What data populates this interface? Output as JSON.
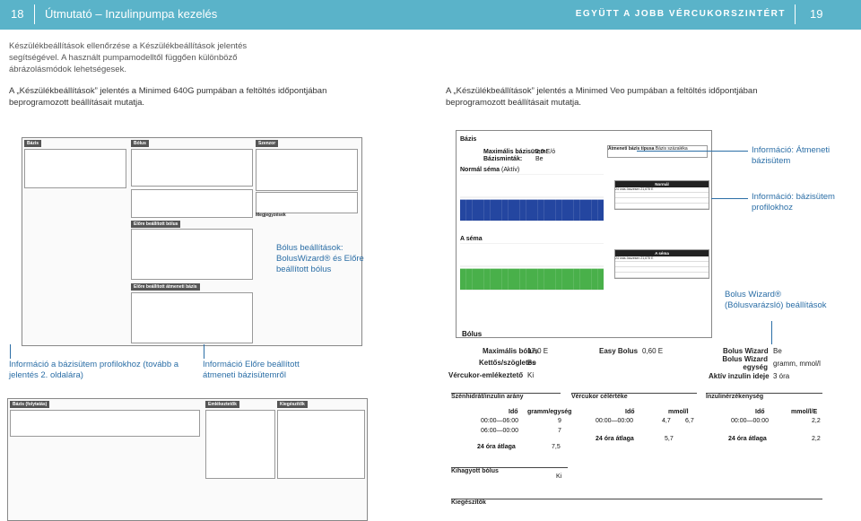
{
  "header": {
    "page_left": "18",
    "title_left": "Útmutató – Inzulinpumpa kezelés",
    "title_right": "EGYÜTT A JOBB VÉRCUKORSZINTÉRT",
    "page_right": "19"
  },
  "intro": "Készülékbeállítások ellenőrzése a Készülékbeállítások jelentés segítségével. A használt pumpamodelltől függően különböző ábrázolásmódok lehetségesek.",
  "caption_left": "A „Készülékbeállítások” jelentés a Minimed 640G pumpában a feltöltés időpontjában beprogramozott beállításait mutatja.",
  "caption_right": "A „Készülékbeállítások” jelentés a Minimed Veo pumpában a feltöltés időpontjában beprogramozott beállításait mutatja.",
  "notes": {
    "temp_basal": "Információ: Átmeneti bázisütem",
    "basal_profiles": "Információ: bázisütem profilokhoz",
    "bolus_settings": "Bólus beállítások: BolusWizard® és Előre beállított bólus",
    "bolus_wizard": "Bolus Wizard® (Bólusvarázsló) beállítások",
    "basal_info_continued": "Információ a bázisütem profilokhoz (tovább a jelentés 2. oldalára)",
    "preset_temp": "Információ Előre beállított átmeneti bázisütemről"
  },
  "mini640": {
    "bazis": "Bázis",
    "bolus": "Bólus",
    "szenzor": "Szenzor",
    "elore_bolus": "Előre beállított bólus",
    "elore_atmeneti": "Előre beállított átmeneti bázis",
    "bazis_folytatas": "Bázis (folytatás)",
    "emlekeztetok": "Emlékeztetők",
    "kiegeszitok": "Kiegészítők",
    "megjegyzesek": "Megjegyzések"
  },
  "veo": {
    "title": "Bázis",
    "max_basal_label": "Maximális bázisütem:",
    "max_basal_value": "2,0 E/ó",
    "basal_patterns_label": "Bázisminták:",
    "basal_patterns_value": "Be",
    "normal_label": "Normál séma",
    "active": "(Aktív)",
    "a_schema": "A séma",
    "temp_basal_type_label": "Átmeneti bázis típusa",
    "temp_basal_type_value": "Bázis százaléka",
    "normal_table_title": "Normál",
    "a_table_title": "A séma",
    "normal_total": "24 órás összesen 21,675 E",
    "a_total": "24 órás összesen 21,675 E",
    "bolus_title": "Bólus",
    "max_bolus_label": "Maximális bólus",
    "max_bolus_value": "17,0 E",
    "dual_square_label": "Kettős/szögletes",
    "dual_square_value": "Be",
    "bg_reminder_label": "Vércukor-emlékeztető",
    "bg_reminder_value": "Ki",
    "easy_bolus_label": "Easy Bolus",
    "easy_bolus_value": "0,60 E",
    "bolus_wizard_label": "Bolus Wizard",
    "bolus_wizard_value": "Be",
    "bw_unit_label": "Bolus Wizard egység",
    "bw_unit_value": "gramm, mmol/l",
    "active_insulin_label": "Aktív inzulin ideje",
    "active_insulin_value": "3 óra",
    "carb_ratio_title": "Szénhidrát/inzulin arány",
    "bg_target_title": "Vércukor célértéke",
    "isf_title": "Inzulinérzékenység",
    "col_ido": "Idő",
    "col_gram": "gramm/egység",
    "col_mmol": "mmol/l",
    "col_mmol_e": "mmol/l/E",
    "carb_rows": [
      [
        "00:00—06:00",
        "9"
      ],
      [
        "06:00—00:00",
        "7"
      ]
    ],
    "carb_avg_label": "24 óra átlaga",
    "carb_avg": "7,5",
    "bg_row": [
      "00:00—00:00",
      "4,7",
      "6,7"
    ],
    "bg_avg_label": "24 óra átlaga",
    "bg_avg": "5,7",
    "bg_avg2": "5,7",
    "isf_rows": [
      [
        "00:00—00:00",
        "2,2"
      ]
    ],
    "isf_avg_label": "24 óra átlaga",
    "isf_avg": "2,2",
    "square_bolus_label": "Kihagyott bólus",
    "square_bolus_value": "Ki",
    "accessories": "Kiegészítők"
  },
  "chart_data": [
    {
      "type": "bar",
      "title": "Normál séma",
      "values": [
        0.9,
        0.9,
        0.9,
        0.9,
        0.9,
        0.9,
        0.9,
        0.9,
        0.9,
        0.9,
        0.9,
        0.9,
        0.9,
        0.9,
        0.9,
        0.9,
        0.9,
        0.9,
        0.9,
        0.9,
        0.9,
        0.9,
        0.9,
        0.9
      ],
      "ylim": [
        0,
        2
      ]
    },
    {
      "type": "bar",
      "title": "A séma",
      "values": [
        0.9,
        0.9,
        0.9,
        0.9,
        0.9,
        0.9,
        0.9,
        0.9,
        0.9,
        0.9,
        0.9,
        0.9,
        0.9,
        0.9,
        0.9,
        0.9,
        0.9,
        0.9,
        0.9,
        0.9,
        0.9,
        0.9,
        0.9,
        0.9
      ],
      "ylim": [
        0,
        2
      ]
    }
  ],
  "colors": {
    "header": "#5ab3c9",
    "accent": "#2b6ea6",
    "normal_bars": "#2446a0",
    "a_bars": "#49b04a"
  }
}
